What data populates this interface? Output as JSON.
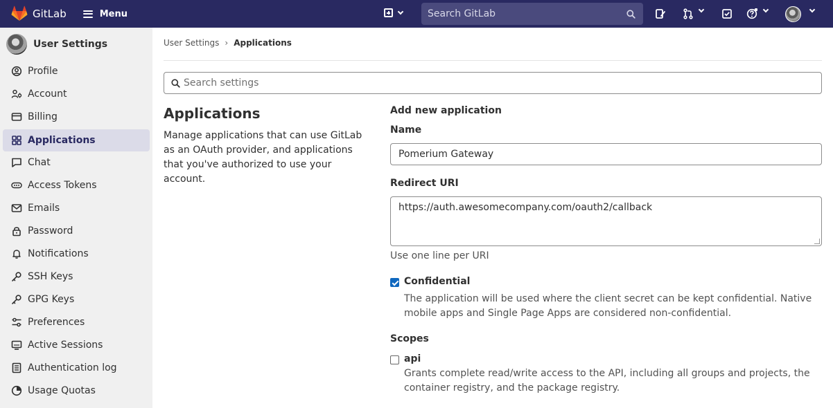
{
  "topbar": {
    "brand": "GitLab",
    "menu_label": "Menu",
    "search_placeholder": "Search GitLab",
    "colors": {
      "bg": "#292961",
      "search_bg": "#4a4a7d"
    }
  },
  "sidebar": {
    "title": "User Settings",
    "items": [
      {
        "label": "Profile",
        "icon": "profile-icon"
      },
      {
        "label": "Account",
        "icon": "account-icon"
      },
      {
        "label": "Billing",
        "icon": "billing-icon"
      },
      {
        "label": "Applications",
        "icon": "applications-icon",
        "active": true
      },
      {
        "label": "Chat",
        "icon": "chat-icon"
      },
      {
        "label": "Access Tokens",
        "icon": "token-icon"
      },
      {
        "label": "Emails",
        "icon": "mail-icon"
      },
      {
        "label": "Password",
        "icon": "lock-icon"
      },
      {
        "label": "Notifications",
        "icon": "bell-icon"
      },
      {
        "label": "SSH Keys",
        "icon": "key-icon"
      },
      {
        "label": "GPG Keys",
        "icon": "key-icon"
      },
      {
        "label": "Preferences",
        "icon": "preferences-icon"
      },
      {
        "label": "Active Sessions",
        "icon": "monitor-icon"
      },
      {
        "label": "Authentication log",
        "icon": "log-icon"
      },
      {
        "label": "Usage Quotas",
        "icon": "quota-icon"
      }
    ]
  },
  "breadcrumb": {
    "parent": "User Settings",
    "separator": "›",
    "current": "Applications"
  },
  "search_settings": {
    "placeholder": "Search settings"
  },
  "section": {
    "title": "Applications",
    "description": "Manage applications that can use GitLab as an OAuth provider, and applications that you've authorized to use your account."
  },
  "form": {
    "heading": "Add new application",
    "name_label": "Name",
    "name_value": "Pomerium Gateway",
    "redirect_label": "Redirect URI",
    "redirect_value": "https://auth.awesomecompany.com/oauth2/callback",
    "redirect_help": "Use one line per URI",
    "confidential_label": "Confidential",
    "confidential_checked": true,
    "confidential_help": "The application will be used where the client secret can be kept confidential. Native mobile apps and Single Page Apps are considered non-confidential.",
    "scopes_label": "Scopes",
    "scopes": [
      {
        "name": "api",
        "checked": false,
        "description": "Grants complete read/write access to the API, including all groups and projects, the container registry, and the package registry."
      }
    ]
  }
}
